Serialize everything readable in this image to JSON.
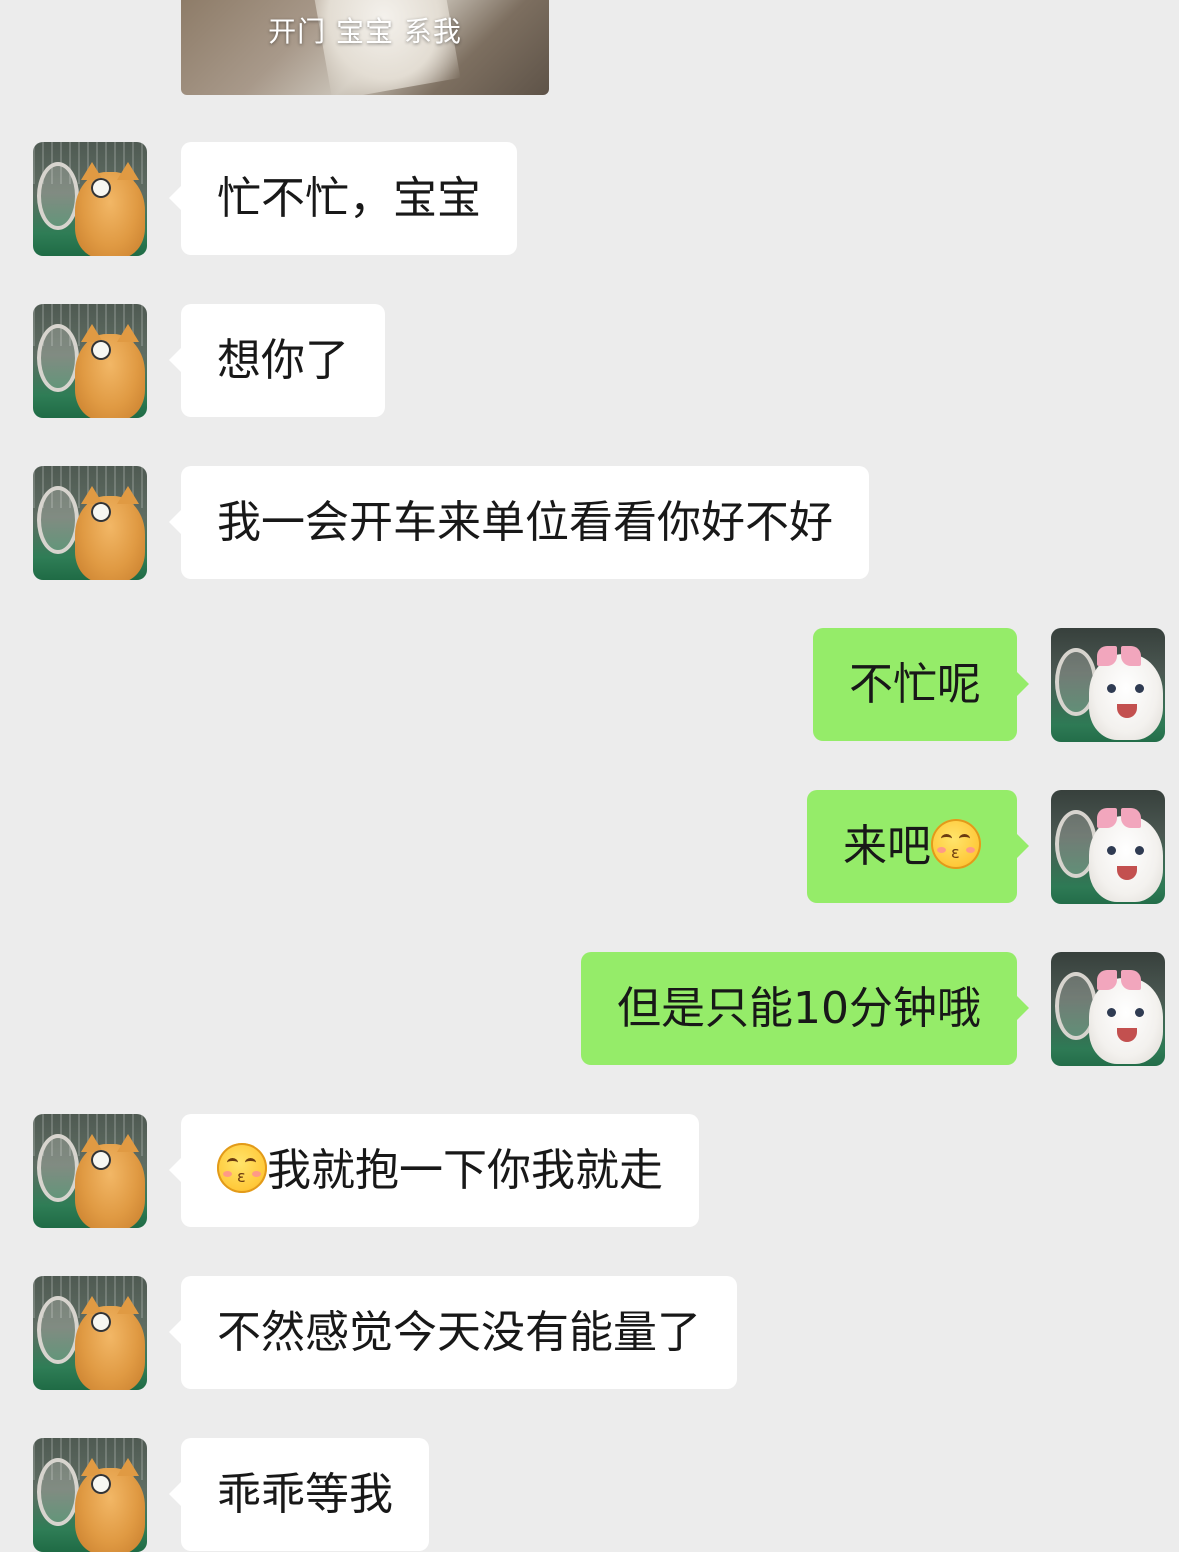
{
  "chat": {
    "image_caption": "开门 宝宝 系我",
    "messages": [
      {
        "side": "in",
        "text": "忙不忙，宝宝"
      },
      {
        "side": "in",
        "text": "想你了"
      },
      {
        "side": "in",
        "text": "我一会开车来单位看看你好不好"
      },
      {
        "side": "out",
        "text": "不忙呢"
      },
      {
        "side": "out",
        "text": "来吧",
        "emoji_after": "kissing-smiling-eyes-emoji"
      },
      {
        "side": "out",
        "text": "但是只能10分钟哦"
      },
      {
        "side": "in",
        "text": "我就抱一下你我就走",
        "emoji_before": "kissing-smiling-eyes-emoji"
      },
      {
        "side": "in",
        "text": "不然感觉今天没有能量了"
      },
      {
        "side": "in",
        "text": "乖乖等我"
      }
    ],
    "avatars": {
      "contact": "orange-cat-badminton-avatar",
      "self": "white-cat-pink-bow-avatar"
    },
    "colors": {
      "background": "#ececec",
      "incoming_bubble": "#ffffff",
      "outgoing_bubble": "#95ec69",
      "text": "#181818"
    }
  }
}
